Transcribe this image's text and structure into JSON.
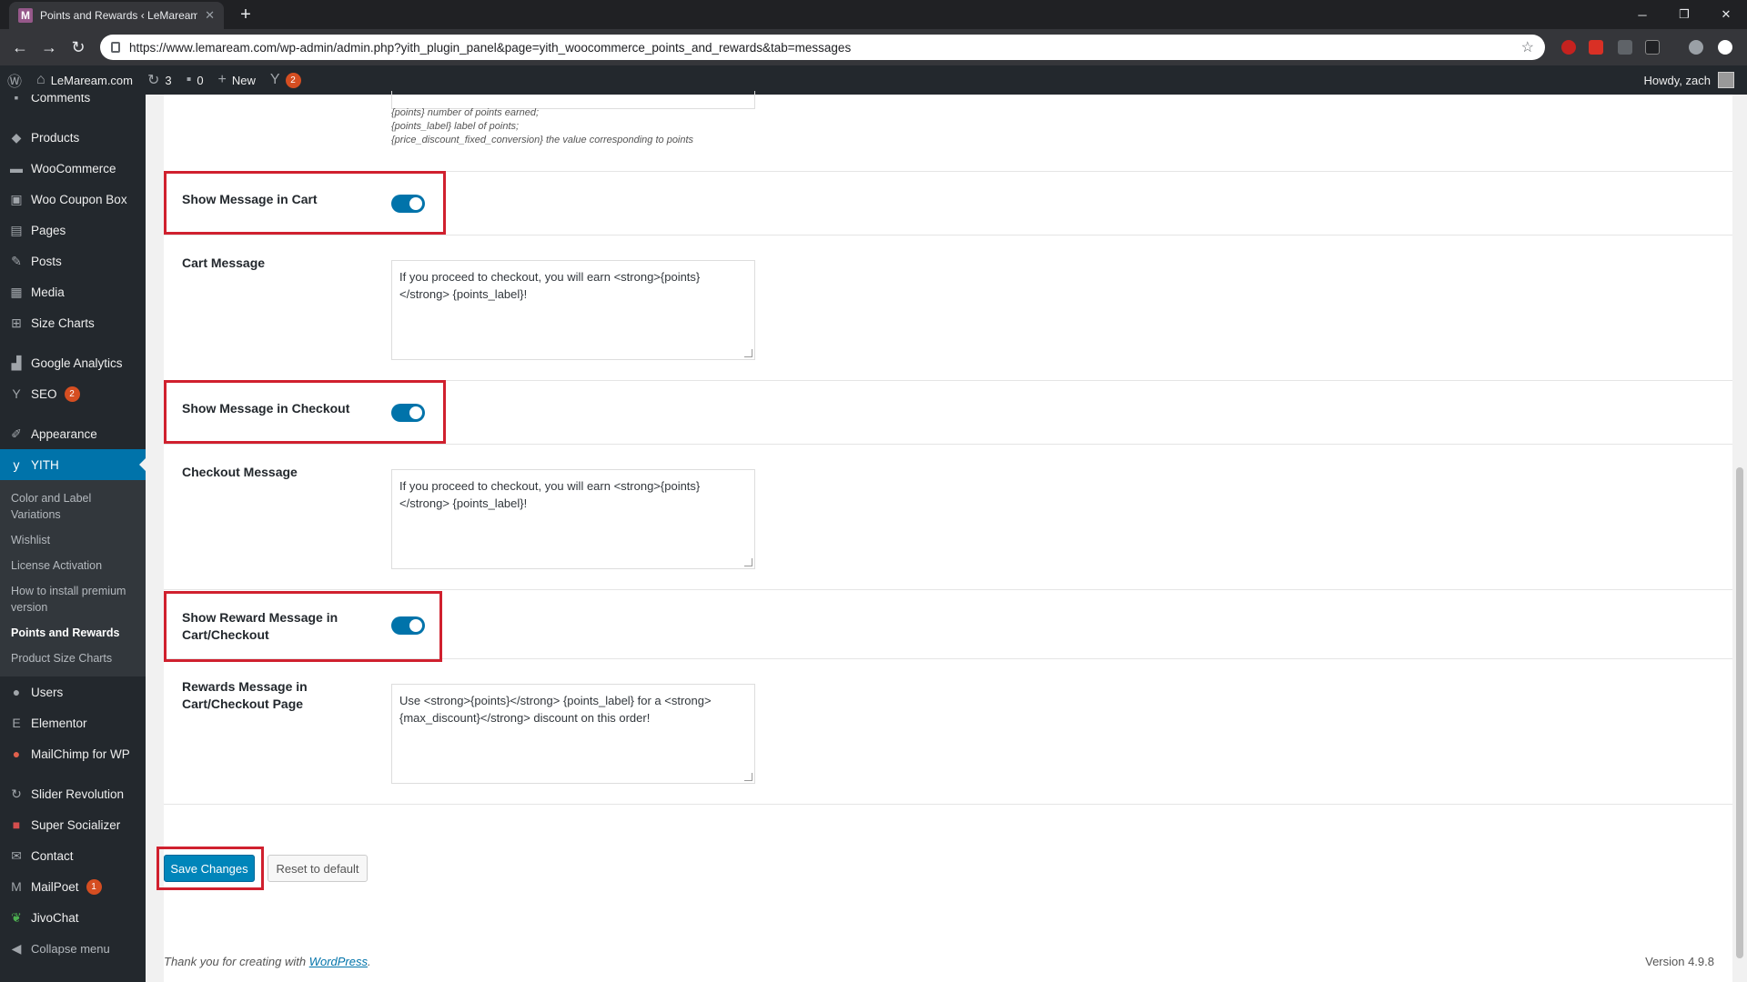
{
  "browser": {
    "tab_title": "Points and Rewards ‹ LeMaream...",
    "tab_favicon": "M",
    "url": "https://www.lemaream.com/wp-admin/admin.php?yith_plugin_panel&page=yith_woocommerce_points_and_rewards&tab=messages"
  },
  "adminbar": {
    "site_name": "LeMaream.com",
    "updates_count": "3",
    "comments_count": "0",
    "new_label": "New",
    "yoast_count": "2",
    "howdy": "Howdy, zach"
  },
  "sidebar": {
    "items": [
      {
        "label": "Comments",
        "icon": "comment-icon"
      },
      {
        "label": "Products",
        "icon": "box-icon"
      },
      {
        "label": "WooCommerce",
        "icon": "woo-icon"
      },
      {
        "label": "Woo Coupon Box",
        "icon": "gift-icon"
      },
      {
        "label": "Pages",
        "icon": "page-icon"
      },
      {
        "label": "Posts",
        "icon": "pin-icon"
      },
      {
        "label": "Media",
        "icon": "media-icon"
      },
      {
        "label": "Size Charts",
        "icon": "grid-icon"
      },
      {
        "label": "Google Analytics",
        "icon": "chart-icon"
      },
      {
        "label": "SEO",
        "icon": "yoast-icon",
        "badge": "2"
      },
      {
        "label": "Appearance",
        "icon": "brush-icon"
      },
      {
        "label": "YITH",
        "icon": "yith-icon"
      }
    ],
    "submenu": [
      "Color and Label Variations",
      "Wishlist",
      "License Activation",
      "How to install premium version",
      "Points and Rewards",
      "Product Size Charts"
    ],
    "items_after": [
      {
        "label": "Users",
        "icon": "user-icon"
      },
      {
        "label": "Elementor",
        "icon": "elementor-icon"
      },
      {
        "label": "MailChimp for WP",
        "icon": "mailchimp-icon"
      },
      {
        "label": "Slider Revolution",
        "icon": "refresh-icon"
      },
      {
        "label": "Super Socializer",
        "icon": "share-icon"
      },
      {
        "label": "Contact",
        "icon": "mail-icon"
      },
      {
        "label": "MailPoet",
        "icon": "mailpoet-icon",
        "badge": "1"
      },
      {
        "label": "JivoChat",
        "icon": "leaf-icon"
      },
      {
        "label": "Collapse menu",
        "icon": "collapse-icon"
      }
    ]
  },
  "main": {
    "hints": [
      "{points} number of points earned;",
      "{points_label} label of points;",
      "{price_discount_fixed_conversion} the value corresponding to points"
    ],
    "show_cart_label": "Show Message in Cart",
    "show_cart_enabled": true,
    "cart_message_label": "Cart Message",
    "cart_message_value": "If you proceed to checkout, you will earn <strong>{points}</strong> {points_label}!",
    "show_checkout_label": "Show Message in Checkout",
    "show_checkout_enabled": true,
    "checkout_message_label": "Checkout Message",
    "checkout_message_value": "If you proceed to checkout, you will earn <strong>{points}</strong> {points_label}!",
    "show_reward_label": "Show Reward Message in Cart/Checkout",
    "show_reward_enabled": true,
    "reward_message_label": "Rewards Message in Cart/Checkout Page",
    "reward_message_value": "Use <strong>{points}</strong> {points_label} for a <strong>{max_discount}</strong> discount on this order!",
    "save_label": "Save Changes",
    "reset_label": "Reset to default"
  },
  "footer": {
    "thanks_prefix": "Thank you for creating with",
    "thanks_link": "WordPress",
    "version": "Version 4.9.8"
  },
  "colors": {
    "admin_dark": "#23282d",
    "accent": "#0073aa",
    "highlight_box": "#d0202e"
  }
}
